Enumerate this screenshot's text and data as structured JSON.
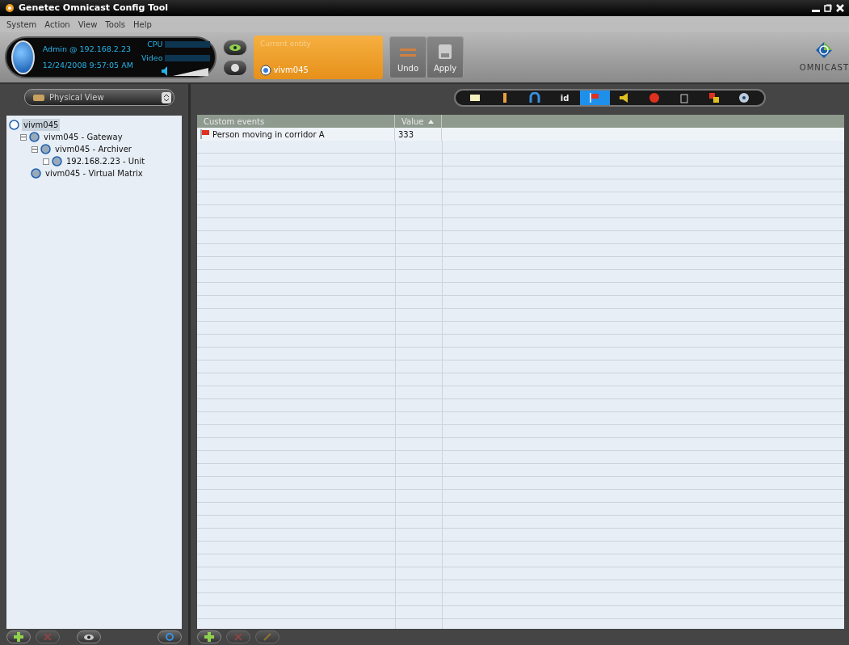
{
  "window": {
    "title": "Genetec Omnicast Config Tool"
  },
  "menu": [
    "System",
    "Action",
    "View",
    "Tools",
    "Help"
  ],
  "status_panel": {
    "user": "Admin @ 192.168.2.23",
    "datetime": "12/24/2008 9:57:05 AM",
    "cpu_label": "CPU",
    "video_label": "Video"
  },
  "current_entity": {
    "label": "Current entity",
    "name": "vivm045"
  },
  "actions": [
    {
      "label": "Undo",
      "disabled": true
    },
    {
      "label": "Apply",
      "disabled": true
    }
  ],
  "logo": {
    "text": "OMNICAST"
  },
  "view_selector": {
    "value": "Physical View"
  },
  "tree": [
    {
      "label": "vivm045",
      "selected": true,
      "children": [
        {
          "label": "vivm045 - Gateway",
          "selected": false,
          "expanded": true,
          "children": [
            {
              "label": "vivm045 - Archiver",
              "selected": false,
              "expanded": true,
              "children": [
                {
                  "label": "192.168.2.23 - Unit",
                  "selected": false,
                  "expanded": false
                }
              ]
            }
          ]
        },
        {
          "label": "vivm045 - Virtual Matrix",
          "selected": false
        }
      ]
    }
  ],
  "filter_tabs": [
    {
      "kind": "icon",
      "selected": false
    },
    {
      "kind": "icon",
      "selected": false
    },
    {
      "kind": "icon",
      "selected": false
    },
    {
      "kind": "text",
      "label": "id",
      "selected": false
    },
    {
      "kind": "icon",
      "selected": true
    },
    {
      "kind": "icon",
      "selected": false
    },
    {
      "kind": "icon",
      "selected": false
    },
    {
      "kind": "icon",
      "selected": false
    },
    {
      "kind": "icon",
      "selected": false
    },
    {
      "kind": "icon",
      "selected": false
    }
  ],
  "table": {
    "columns": [
      {
        "label": "Custom events"
      },
      {
        "label": "Value",
        "sorted": true
      }
    ],
    "rows": [
      {
        "event": "Person moving in corridor A",
        "value": "333"
      }
    ]
  }
}
